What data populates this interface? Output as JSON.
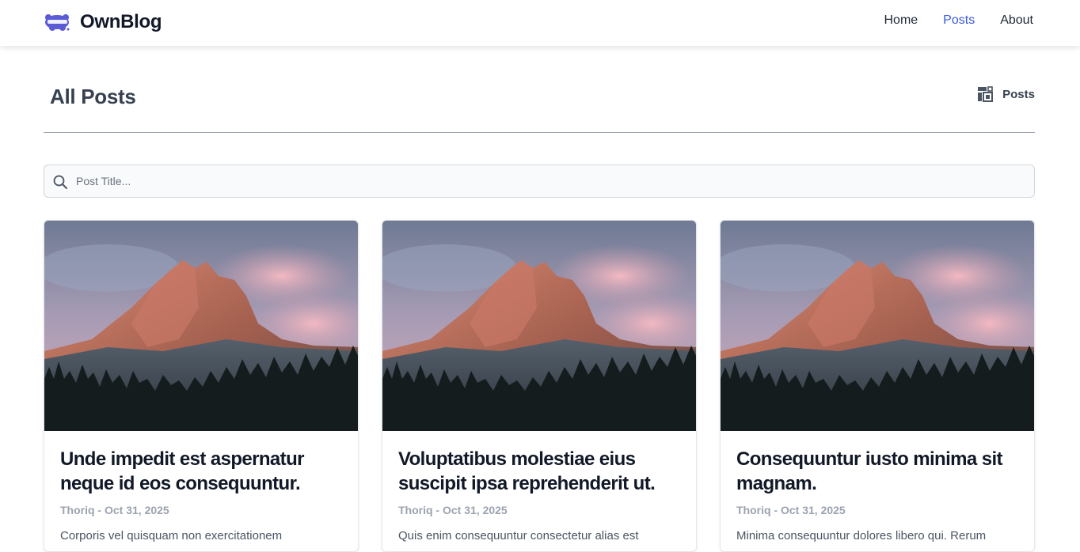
{
  "navbar": {
    "brand": "OwnBlog",
    "links": [
      {
        "label": "Home"
      },
      {
        "label": "Posts"
      },
      {
        "label": "About"
      }
    ],
    "accent_color": "#3b5bdb"
  },
  "page": {
    "title": "All Posts",
    "crumb_label": "Posts",
    "crumb_icon": "layout-icon"
  },
  "search": {
    "placeholder": "Post Title...",
    "value": ""
  },
  "posts": [
    {
      "title": "Unde impedit est aspernatur neque id eos consequuntur.",
      "meta": "Thoriq - Oct 31, 2025",
      "excerpt": "Corporis vel quisquam non exercitationem"
    },
    {
      "title": "Voluptatibus molestiae eius suscipit ipsa reprehenderit ut.",
      "meta": "Thoriq - Oct 31, 2025",
      "excerpt": "Quis enim consequuntur consectetur alias est"
    },
    {
      "title": "Consequuntur iusto minima sit magnam.",
      "meta": "Thoriq - Oct 31, 2025",
      "excerpt": "Minima consequuntur dolores libero qui. Rerum"
    }
  ]
}
